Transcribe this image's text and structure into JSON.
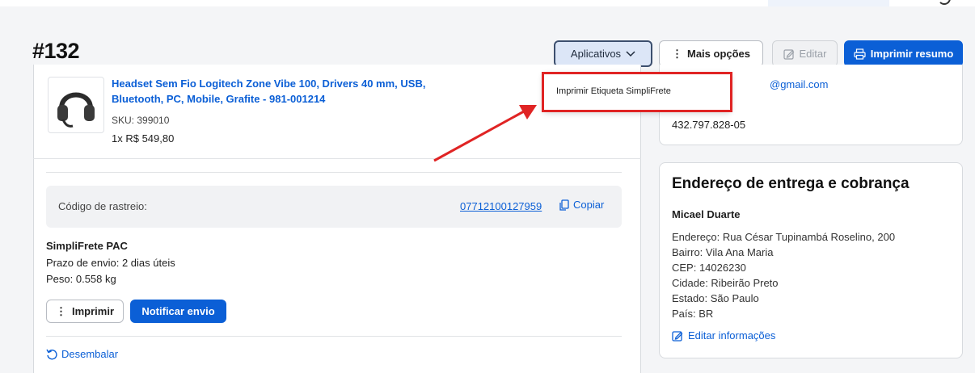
{
  "header": {
    "order_number": "#132",
    "apps_label": "Aplicativos",
    "more_label": "Mais opções",
    "edit_label": "Editar",
    "print_summary_label": "Imprimir resumo"
  },
  "apps_menu": {
    "items": [
      "Imprimir Etiqueta SimpliFrete"
    ]
  },
  "product": {
    "name": "Headset Sem Fio Logitech Zone Vibe 100, Drivers 40 mm, USB, Bluetooth, PC, Mobile, Grafite - 981-001214",
    "sku": "SKU: 399010",
    "quantity_price": "1x R$ 549,80"
  },
  "tracking": {
    "label": "Código de rastreio:",
    "code": "07712100127959",
    "copy_label": "Copiar"
  },
  "shipping": {
    "method": "SimpliFrete PAC",
    "deadline": "Prazo de envio: 2 dias úteis",
    "weight": "Peso: 0.558 kg",
    "print_label": "Imprimir",
    "notify_label": "Notificar envio",
    "unpack_label": "Desembalar"
  },
  "customer": {
    "email_partial": "@gmail.com",
    "document": "432.797.828-05"
  },
  "address": {
    "title": "Endereço de entrega e cobrança",
    "name": "Micael Duarte",
    "lines": [
      "Endereço: Rua César Tupinambá Roselino, 200",
      "Bairro: Vila Ana Maria",
      "CEP: 14026230",
      "Cidade: Ribeirão Preto",
      "Estado: São Paulo",
      "País: BR"
    ],
    "edit_label": "Editar informações"
  },
  "colors": {
    "primary": "#0b5fd6",
    "annotation": "#e02424"
  }
}
